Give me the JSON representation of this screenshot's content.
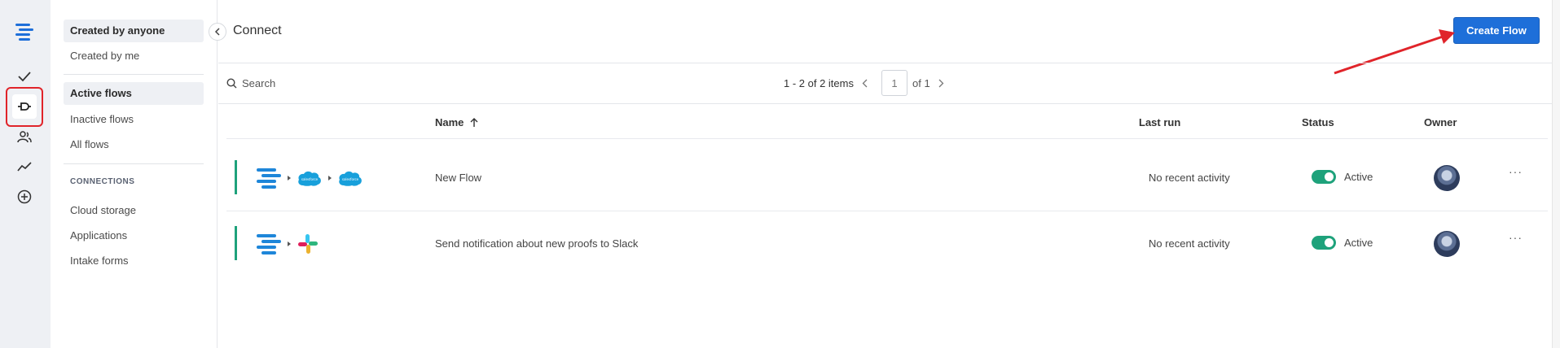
{
  "rail": {
    "icons": [
      "menu-logo-icon",
      "check-icon",
      "connect-plug-icon",
      "people-icon",
      "trend-chart-icon",
      "plus-circle-icon"
    ]
  },
  "panel": {
    "filters_top": [
      "Created by anyone",
      "Created by me"
    ],
    "filters_flows": [
      "Active flows",
      "Inactive flows",
      "All flows"
    ],
    "section_label": "CONNECTIONS",
    "connections": [
      "Cloud storage",
      "Applications",
      "Intake forms"
    ]
  },
  "main": {
    "title": "Connect",
    "create_button": "Create Flow",
    "search_placeholder": "Search",
    "pager": {
      "count": "1 - 2 of 2 items",
      "page": "1",
      "of": "of 1"
    },
    "columns": {
      "name": "Name",
      "last_run": "Last run",
      "status": "Status",
      "owner": "Owner"
    },
    "rows": [
      {
        "name": "New Flow",
        "last_run": "No recent activity",
        "status": "Active",
        "apps": [
          "ziflow",
          "salesforce",
          "salesforce"
        ]
      },
      {
        "name": "Send notification about new proofs to Slack",
        "last_run": "No recent activity",
        "status": "Active",
        "apps": [
          "ziflow",
          "slack"
        ]
      }
    ]
  },
  "colors": {
    "accent": "#1e6fd9",
    "active_green": "#1ea27b",
    "highlight_red": "#e0242a"
  }
}
